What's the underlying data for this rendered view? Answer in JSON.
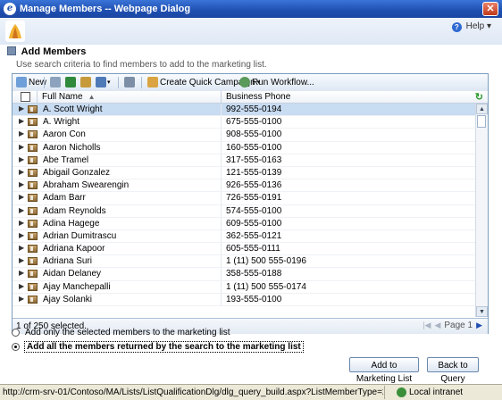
{
  "window": {
    "title": "Manage Members -- Webpage Dialog",
    "close_label": "✕"
  },
  "help": {
    "label": "Help",
    "caret": "▾"
  },
  "dialog": {
    "title": "Add Members",
    "description": "Use search criteria to find members to add to the marketing list."
  },
  "toolbar": {
    "new_label": "New",
    "create_campaign_label": "Create Quick Campaign",
    "run_workflow_label": "Run Workflow..."
  },
  "grid": {
    "columns": [
      "Full Name",
      "Business Phone"
    ],
    "rows": [
      {
        "name": "A. Scott Wright",
        "phone": "992-555-0194"
      },
      {
        "name": "A. Wright",
        "phone": "675-555-0100"
      },
      {
        "name": "Aaron Con",
        "phone": "908-555-0100"
      },
      {
        "name": "Aaron Nicholls",
        "phone": "160-555-0100"
      },
      {
        "name": "Abe Tramel",
        "phone": "317-555-0163"
      },
      {
        "name": "Abigail Gonzalez",
        "phone": "121-555-0139"
      },
      {
        "name": "Abraham Swearengin",
        "phone": "926-555-0136"
      },
      {
        "name": "Adam Barr",
        "phone": "726-555-0191"
      },
      {
        "name": "Adam Reynolds",
        "phone": "574-555-0100"
      },
      {
        "name": "Adina Hagege",
        "phone": "609-555-0100"
      },
      {
        "name": "Adrian Dumitrascu",
        "phone": "362-555-0121"
      },
      {
        "name": "Adriana Kapoor",
        "phone": "605-555-0111"
      },
      {
        "name": "Adriana Suri",
        "phone": "1 (11) 500 555-0196"
      },
      {
        "name": "Aidan Delaney",
        "phone": "358-555-0188"
      },
      {
        "name": "Ajay Manchepalli",
        "phone": "1 (11) 500 555-0174"
      },
      {
        "name": "Ajay Solanki",
        "phone": "193-555-0100"
      }
    ],
    "selected_count_text": "1 of 250 selected.",
    "page_text": "Page 1"
  },
  "options": {
    "selected_only_label": "Add only the selected members to the marketing list",
    "all_results_label": "Add all the members returned by the search to the marketing list"
  },
  "buttons": {
    "add_label": "Add to Marketing List",
    "back_label": "Back to Query"
  },
  "statusbar": {
    "url": "http://crm-srv-01/Contoso/MA/Lists/ListQualificationDlg/dlg_query_build.aspx?ListMemberType=2&ListId={B0779987-C284-DF11-9F",
    "zone": "Local intranet"
  }
}
